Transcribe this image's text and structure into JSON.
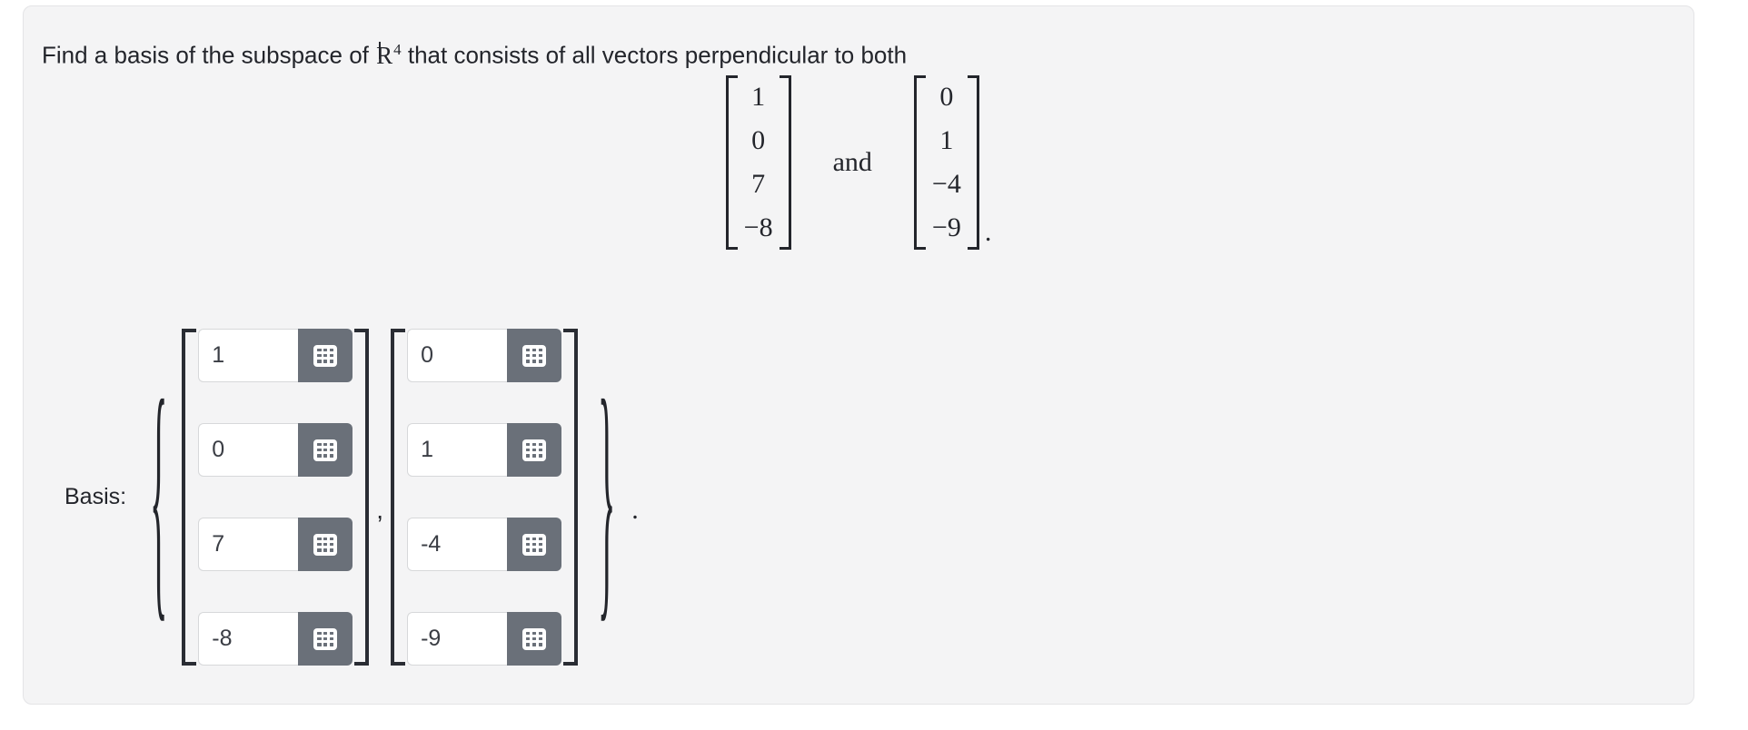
{
  "card": {
    "background_color": "#f4f4f5",
    "border_color": "#e4e4e6"
  },
  "prompt": {
    "text_before": "Find a basis of the subspace of ",
    "space_symbol": "R",
    "space_exponent": "4",
    "text_after": " that consists of all vectors perpendicular to both"
  },
  "given_vectors": {
    "conjunction": "and",
    "terminal_punctuation": ".",
    "vector_1": [
      "1",
      "0",
      "7",
      "−8"
    ],
    "vector_2": [
      "0",
      "1",
      "−4",
      "−9"
    ]
  },
  "answer": {
    "label": "Basis:",
    "open_brace": "{",
    "close_brace": "}",
    "separator": ",",
    "terminal_punctuation": ".",
    "keypad_icon_name": "keypad-grid-icon",
    "input_placeholder": "",
    "columns": [
      {
        "name": "basis-vector-1",
        "values": [
          "1",
          "0",
          "7",
          "-8"
        ]
      },
      {
        "name": "basis-vector-2",
        "values": [
          "0",
          "1",
          "-4",
          "-9"
        ]
      }
    ]
  },
  "colors": {
    "keypad_button": "#6a7079",
    "input_background": "#ffffff",
    "input_border": "#d7d8da",
    "text": "#23252b",
    "bracket": "#2a2d34"
  }
}
